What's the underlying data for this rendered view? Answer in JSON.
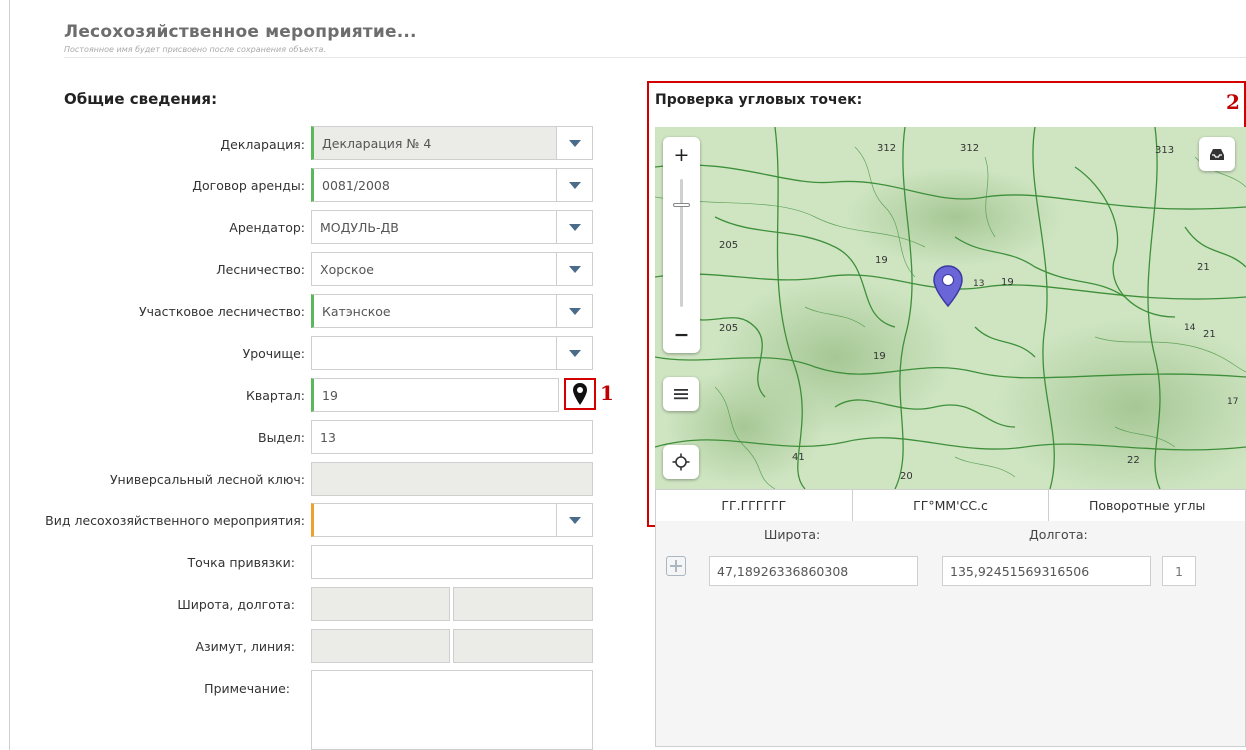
{
  "header": {
    "title": "Лесохозяйственное мероприятие...",
    "subtitle": "Постоянное имя будет присвоено после сохранения объекта."
  },
  "general": {
    "title": "Общие сведения:",
    "declaration_label": "Декларация:",
    "declaration_value": "Декларация № 4",
    "lease_label": "Договор аренды:",
    "lease_value": "0081/2008",
    "tenant_label": "Арендатор:",
    "tenant_value": "МОДУЛЬ-ДВ",
    "forestry_label": "Лесничество:",
    "forestry_value": "Хорское",
    "district_label": "Участковое лесничество:",
    "district_value": "Катэнское",
    "tract_label": "Урочище:",
    "tract_value": "",
    "quarter_label": "Квартал:",
    "quarter_value": "19",
    "allotment_label": "Выдел:",
    "allotment_value": "13",
    "key_label": "Универсальный лесной ключ:",
    "key_value": "",
    "activity_label": "Вид лесохозяйственного мероприятия:",
    "activity_value": "",
    "anchor_label": "Точка привязки:",
    "anchor_value": "",
    "latlon_label": "Широта, долгота:",
    "azimuth_label": "Азимут, линия:",
    "note_label": "Примечание:"
  },
  "markers": {
    "m1": "1",
    "m2": "2"
  },
  "check": {
    "title": "Проверка угловых точек:",
    "tabs": [
      "ГГ.ГГГГГГ",
      "ГГ°ММ'СС.с",
      "Поворотные углы"
    ],
    "lat_header": "Широта:",
    "lon_header": "Долгота:",
    "lat_value": "47,18926336860308",
    "lon_value": "135,92451569316506",
    "point_index": "1"
  },
  "map": {
    "zoom_in": "+",
    "zoom_out": "−",
    "zoom_level": 0.8,
    "labels": [
      "312",
      "312",
      "313",
      "205",
      "205",
      "19",
      "19",
      "19",
      "21",
      "21",
      "41",
      "22",
      "20",
      "13",
      "14",
      "17"
    ]
  },
  "colors": {
    "accent_red": "#d40000",
    "marker": "#6a66d8",
    "required": "#5cb85c",
    "warning": "#f0a030"
  }
}
